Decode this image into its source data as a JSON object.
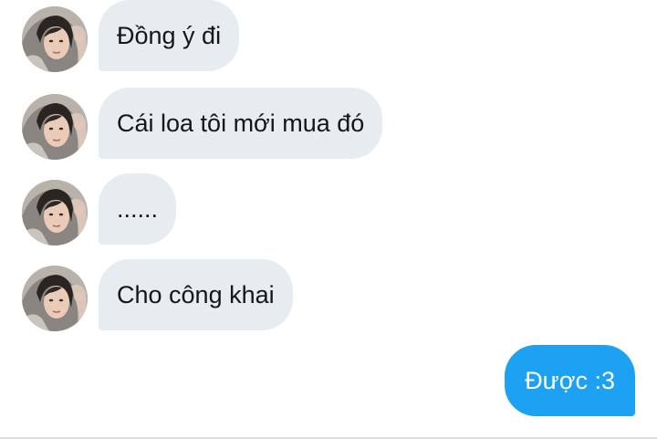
{
  "messages": [
    {
      "from": "other",
      "text": "Đồng ý đi"
    },
    {
      "from": "other",
      "text": "Cái loa tôi mới mua đó"
    },
    {
      "from": "other",
      "text": "......"
    },
    {
      "from": "other",
      "text": "Cho công khai"
    },
    {
      "from": "me",
      "text": "Được :3"
    }
  ],
  "colors": {
    "incoming_bubble": "#e6ecf0",
    "outgoing_bubble": "#1da1f2",
    "incoming_text": "#14171a",
    "outgoing_text": "#ffffff"
  },
  "icons": {
    "avatar": "user-avatar-photo"
  }
}
